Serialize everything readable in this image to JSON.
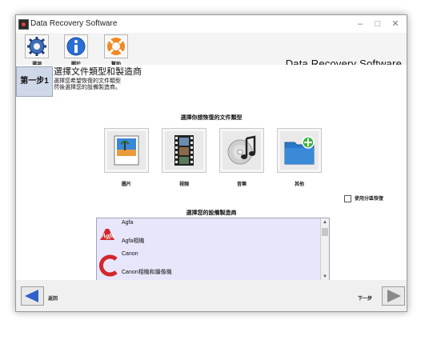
{
  "window": {
    "title": "Data Recovery Software"
  },
  "toolbar": {
    "buttons": [
      {
        "label": "選項",
        "icon": "gear-icon"
      },
      {
        "label": "關於",
        "icon": "info-icon"
      },
      {
        "label": "幫助",
        "icon": "help-lifebuoy-icon"
      }
    ],
    "app_title": "Data Recovery Software"
  },
  "step": {
    "badge": "第一步1",
    "title": "選擇文件類型和製造商",
    "desc_line1": "選擇您希望恢復的文件類型",
    "desc_line2": "然後選擇您的設備製造商。"
  },
  "file_types": {
    "heading": "選擇你想恢復的文件類型",
    "items": [
      {
        "label": "圖片",
        "icon": "picture-icon"
      },
      {
        "label": "視頻",
        "icon": "film-icon"
      },
      {
        "label": "音樂",
        "icon": "music-cd-icon"
      },
      {
        "label": "其他",
        "icon": "folder-add-icon"
      }
    ]
  },
  "partition_option": {
    "label": "使用分區恢復",
    "checked": false
  },
  "manufacturers": {
    "heading": "選擇您的設備製造商",
    "items": [
      {
        "name": "Agfa",
        "sub": "Agfa相機",
        "logo": "agfa-logo-icon"
      },
      {
        "name": "Canon",
        "sub": "Canon相機和攝像機",
        "logo": "canon-logo-icon"
      }
    ]
  },
  "footer": {
    "back_label": "返回",
    "next_label": "下一步"
  },
  "colors": {
    "list_bg": "#e8e6fb",
    "accent_blue": "#2f61c9",
    "agfa_red": "#d2262c"
  }
}
